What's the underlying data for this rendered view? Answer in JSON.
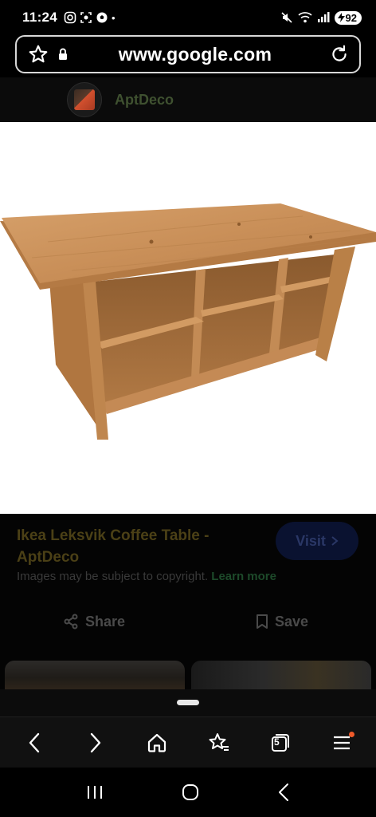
{
  "status_bar": {
    "time": "11:24",
    "battery": "92",
    "dot": "•"
  },
  "url_bar": {
    "url": "www.google.com"
  },
  "site": {
    "name": "AptDeco"
  },
  "result": {
    "title": "Ikea Leksvik Coffee Table - AptDeco",
    "visit_label": "Visit",
    "copyright_text": "Images may be subject to copyright.",
    "learn_more": "Learn more",
    "share_label": "Share",
    "save_label": "Save"
  },
  "toolbar": {
    "tab_count": "5"
  },
  "colors": {
    "background": "#000000",
    "title_dim": "#4b4016",
    "learn_more_dim": "#1d4a2a",
    "visit_button_bg": "#0a1230",
    "notification_dot": "#f05a2a"
  },
  "icons": {
    "status_left": [
      "instagram-icon",
      "screenshot-icon",
      "soccer-ball-icon"
    ],
    "status_right": [
      "mute-icon",
      "wifi-icon",
      "signal-icon",
      "battery-icon"
    ],
    "url_bar": [
      "star-icon",
      "lock-icon",
      "reload-icon"
    ],
    "toolbar": [
      "back-arrow-icon",
      "forward-arrow-icon",
      "home-icon",
      "bookmarks-icon",
      "tabs-icon",
      "menu-icon"
    ],
    "system_nav": [
      "recents-icon",
      "home-circle-icon",
      "back-icon"
    ]
  }
}
